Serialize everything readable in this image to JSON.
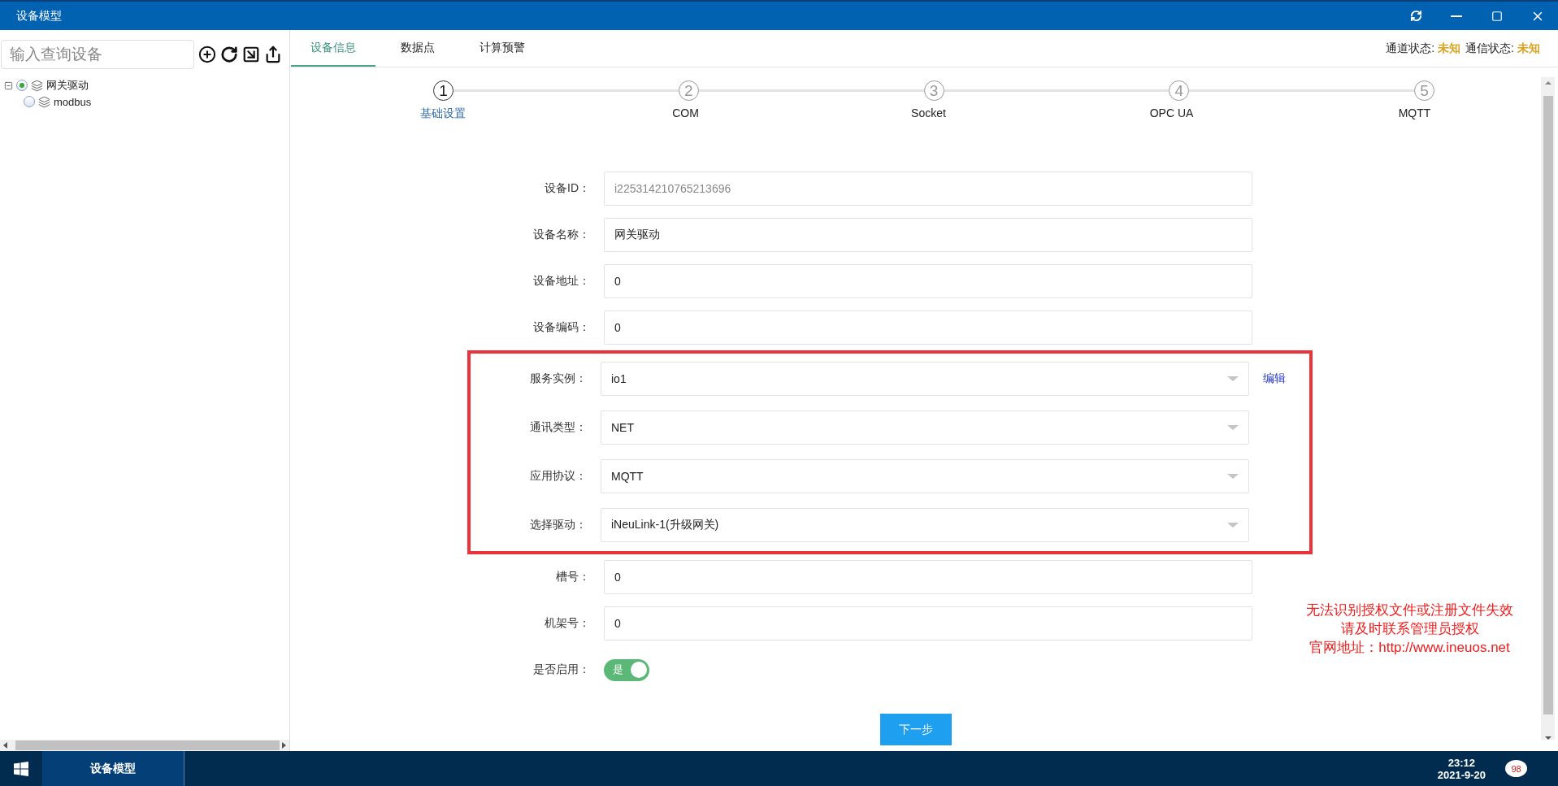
{
  "window": {
    "title": "设备模型"
  },
  "sidebar": {
    "search": {
      "placeholder": "输入查询设备"
    },
    "tree": [
      {
        "label": "网关驱动",
        "selected": true,
        "expanded": true,
        "children": [
          {
            "label": "modbus",
            "selected": false
          }
        ]
      }
    ]
  },
  "tabs": [
    {
      "label": "设备信息",
      "selected": true
    },
    {
      "label": "数据点",
      "selected": false
    },
    {
      "label": "计算预警",
      "selected": false
    }
  ],
  "status": [
    {
      "label": "通道状态:",
      "value": "未知"
    },
    {
      "label": "通信状态:",
      "value": "未知"
    }
  ],
  "steps": [
    {
      "number": "1",
      "label": "基础设置",
      "selected": true
    },
    {
      "number": "2",
      "label": "COM",
      "selected": false
    },
    {
      "number": "3",
      "label": "Socket",
      "selected": false
    },
    {
      "number": "4",
      "label": "OPC UA",
      "selected": false
    },
    {
      "number": "5",
      "label": "MQTT",
      "selected": false
    }
  ],
  "form": [
    {
      "kind": "text",
      "label": "设备ID：",
      "value": "i225314210765213696",
      "disabled": true,
      "highlighted": false
    },
    {
      "kind": "text",
      "label": "设备名称：",
      "value": "网关驱动",
      "disabled": false,
      "highlighted": false
    },
    {
      "kind": "text",
      "label": "设备地址：",
      "value": "0",
      "disabled": false,
      "highlighted": false
    },
    {
      "kind": "text",
      "label": "设备编码：",
      "value": "0",
      "disabled": false,
      "highlighted": false
    },
    {
      "kind": "select",
      "label": "服务实例：",
      "value": "io1",
      "action": "编辑",
      "highlighted": true
    },
    {
      "kind": "select",
      "label": "通讯类型：",
      "value": "NET",
      "highlighted": true
    },
    {
      "kind": "select",
      "label": "应用协议：",
      "value": "MQTT",
      "highlighted": true
    },
    {
      "kind": "select",
      "label": "选择驱动：",
      "value": "iNeuLink-1(升级网关)",
      "highlighted": true
    },
    {
      "kind": "text",
      "label": "槽号：",
      "value": "0",
      "disabled": false,
      "highlighted": false
    },
    {
      "kind": "text",
      "label": "机架号：",
      "value": "0",
      "disabled": false,
      "highlighted": false
    },
    {
      "kind": "toggle",
      "label": "是否启用：",
      "on": true,
      "on_text": "是",
      "highlighted": false
    }
  ],
  "next_button": "下一步",
  "license_warning": [
    "无法识别授权文件或注册文件失效",
    "请及时联系管理员授权",
    "官网地址：http://www.ineuos.net"
  ],
  "taskbar": {
    "app": "设备模型",
    "time": "23:12",
    "date": "2021-9-20",
    "notifications": "98"
  }
}
